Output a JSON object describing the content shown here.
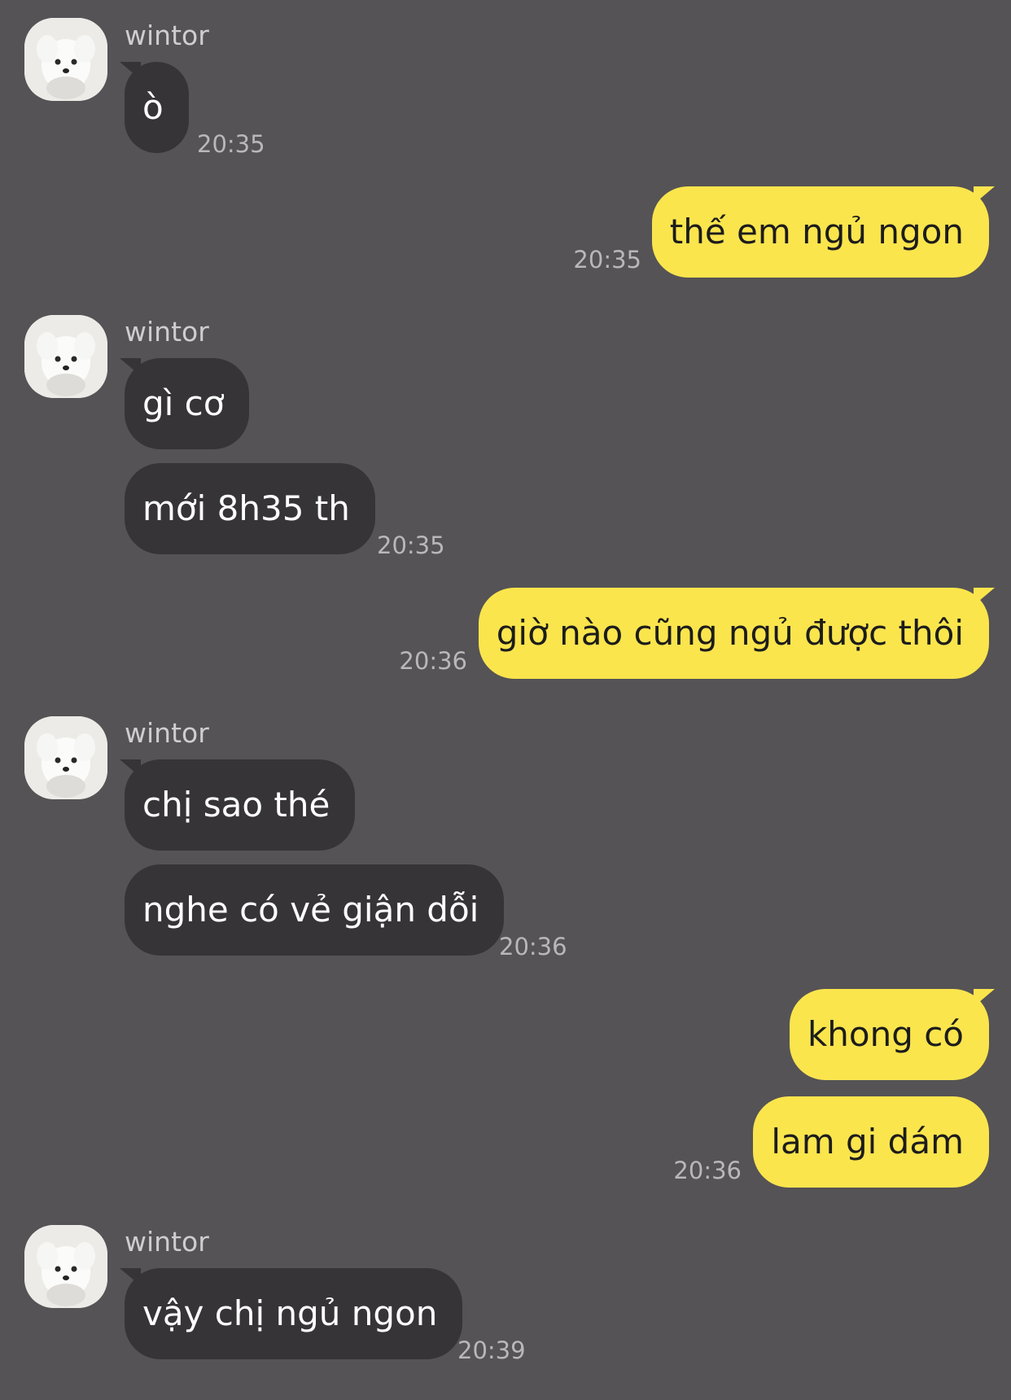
{
  "contact": {
    "name": "wintor",
    "avatar_icon": "white-dog-avatar-icon"
  },
  "colors": {
    "background": "#555355",
    "incoming_bubble": "#363437",
    "outgoing_bubble": "#fbe54d"
  },
  "messages": [
    {
      "id": "m1",
      "direction": "incoming",
      "text": "ò",
      "time": "20:35"
    },
    {
      "id": "m2",
      "direction": "outgoing",
      "text": "thế em ngủ ngon",
      "time": "20:35"
    },
    {
      "id": "m3",
      "direction": "incoming",
      "text": "gì cơ"
    },
    {
      "id": "m4",
      "direction": "incoming",
      "text": "mới 8h35 th",
      "time": "20:35"
    },
    {
      "id": "m5",
      "direction": "outgoing",
      "text": "giờ nào cũng ngủ được thôi",
      "time": "20:36"
    },
    {
      "id": "m6",
      "direction": "incoming",
      "text": "chị sao thé"
    },
    {
      "id": "m7",
      "direction": "incoming",
      "text": "nghe có vẻ giận dỗi",
      "time": "20:36"
    },
    {
      "id": "m8",
      "direction": "outgoing",
      "text": "khong có"
    },
    {
      "id": "m9",
      "direction": "outgoing",
      "text": "lam gi dám",
      "time": "20:36"
    },
    {
      "id": "m10",
      "direction": "incoming",
      "text": "vậy chị ngủ ngon",
      "time": "20:39"
    }
  ]
}
